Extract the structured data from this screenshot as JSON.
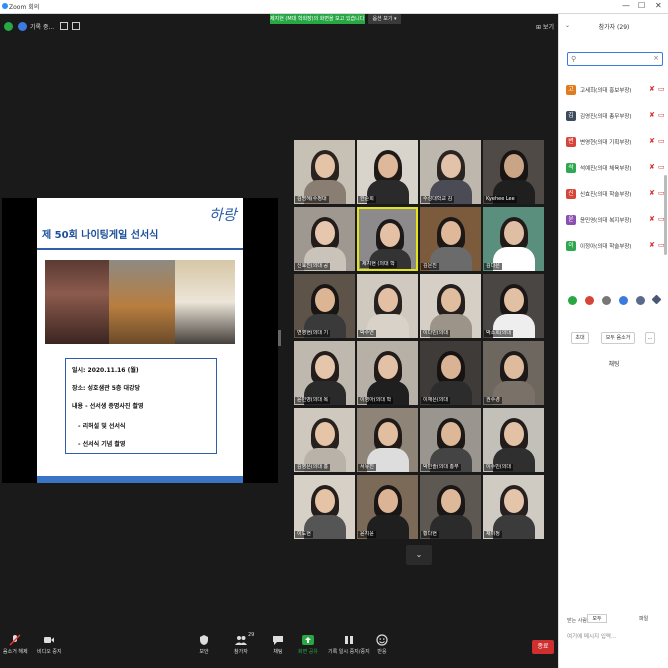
{
  "window": {
    "title": "Zoom 회의",
    "controls": [
      "—",
      "☐",
      "✕"
    ]
  },
  "top": {
    "meeting_label": "기록 중...",
    "banner": "제지현 (M대 학회장)의 화면을 보고 있습니다.",
    "view_button": "옵션 보기 ▾",
    "view_option": "⊞ 보기"
  },
  "slide": {
    "title": "제 50회 나이팅게일 선서식",
    "logo": "하랑",
    "lines": [
      "일시: 2020.11.16 (월)",
      "장소: 성호샘관 5층 대강당",
      "내용 - 선서생 증명사진 촬영",
      "  - 리허설 및 선서식",
      "  - 선서식 기념 촬영"
    ]
  },
  "tiles": [
    {
      "name": "김명혜(수정대",
      "bg": "#c7c0b5",
      "skin": "#e4c3a6",
      "hair": "#2a2320",
      "shirt": "#8a7e72"
    },
    {
      "name": "한준희",
      "bg": "#d8d3cb",
      "skin": "#dfb79b",
      "hair": "#1e1a18",
      "shirt": "#2a2a2a"
    },
    {
      "name": "수성대학교 김",
      "bg": "#bdb7ad",
      "skin": "#e2c2a8",
      "hair": "#2b2522",
      "shirt": "#4b4b55"
    },
    {
      "name": "Kyehee Lee",
      "bg": "#4f4a45",
      "skin": "#caa486",
      "hair": "#171413",
      "shirt": "#1f1f1f"
    },
    {
      "name": "신효진(의대 공",
      "bg": "#9e9890",
      "skin": "#e6c7ad",
      "hair": "#221d1b",
      "shirt": "#c9c3ba"
    },
    {
      "name": "제지현 (의대 학",
      "bg": "#8c8a8a",
      "skin": "#e4c1a4",
      "hair": "#1d1918",
      "shirt": "#333"
    },
    {
      "name": "김은진",
      "bg": "#7c5a3c",
      "skin": "#deb899",
      "hair": "#1c1816",
      "shirt": "#6b6b6b"
    },
    {
      "name": "김다은",
      "bg": "#5b8f7d",
      "skin": "#e0bea3",
      "hair": "#201b19",
      "shirt": "#ffffff"
    },
    {
      "name": "변영현(의대 기",
      "bg": "#5d5349",
      "skin": "#dcb595",
      "hair": "#1a1615",
      "shirt": "#3a3a3a"
    },
    {
      "name": "박수연",
      "bg": "#cfc9bf",
      "skin": "#e3c0a3",
      "hair": "#272120",
      "shirt": "#d8d2c8"
    },
    {
      "name": "이다빈(의대",
      "bg": "#d5cfc6",
      "skin": "#e0bd9f",
      "hair": "#241f1d",
      "shirt": "#9c9488"
    },
    {
      "name": "박소희(의대",
      "bg": "#4a4643",
      "skin": "#e2c0a4",
      "hair": "#1b1716",
      "shirt": "#eeeeee"
    },
    {
      "name": "윤민영(의대 복",
      "bg": "#bfb8ae",
      "skin": "#e6c6ab",
      "hair": "#231e1c",
      "shirt": "#2a2a2a"
    },
    {
      "name": "이영아(의대 학",
      "bg": "#b7b0a6",
      "skin": "#e2c1a6",
      "hair": "#211c1a",
      "shirt": "#1f1f1f"
    },
    {
      "name": "이재은(의대",
      "bg": "#3f3b38",
      "skin": "#d9b394",
      "hair": "#161312",
      "shirt": "#2c2c2c"
    },
    {
      "name": "권수경",
      "bg": "#6e675f",
      "skin": "#dfbb9d",
      "hair": "#1d1918",
      "shirt": "#7a7268"
    },
    {
      "name": "김영은(의대 홍",
      "bg": "#cfc8be",
      "skin": "#e5c4a8",
      "hair": "#28221f",
      "shirt": "#b9b2a8"
    },
    {
      "name": "서유진",
      "bg": "#8e8477",
      "skin": "#e0be9f",
      "hair": "#1f1a18",
      "shirt": "#ddd"
    },
    {
      "name": "박민솔(의대 총무",
      "bg": "#9a958f",
      "skin": "#dcb798",
      "hair": "#1c1816",
      "shirt": "#444"
    },
    {
      "name": "이수빈(의대",
      "bg": "#c3c0ba",
      "skin": "#e3c1a4",
      "hair": "#221d1b",
      "shirt": "#2f2f2f"
    },
    {
      "name": "이도현",
      "bg": "#d6d0c6",
      "skin": "#e4c3a7",
      "hair": "#241f1d",
      "shirt": "#555"
    },
    {
      "name": "윤지윤",
      "bg": "#7b6a58",
      "skin": "#dab494",
      "hair": "#1a1615",
      "shirt": "#1f1f1f"
    },
    {
      "name": "황다현",
      "bg": "#5e5852",
      "skin": "#ddb999",
      "hair": "#1b1716",
      "shirt": "#2b2b2b"
    },
    {
      "name": "채미정",
      "bg": "#cfcac2",
      "skin": "#e5c5aa",
      "hair": "#262120",
      "shirt": "#3b3b3b"
    }
  ],
  "toolbar": {
    "items": [
      {
        "label": "음소거 해제",
        "icon": "mic-muted-icon"
      },
      {
        "label": "비디오 중지",
        "icon": "video-icon"
      },
      {
        "label": "보안",
        "icon": "shield-icon"
      },
      {
        "label": "참가자",
        "icon": "participants-icon",
        "count": "29"
      },
      {
        "label": "채팅",
        "icon": "chat-icon"
      },
      {
        "label": "화면 공유",
        "icon": "share-screen-icon"
      },
      {
        "label": "기록 일시 중지/중지",
        "icon": "pause-record-icon"
      },
      {
        "label": "반응",
        "icon": "reactions-icon"
      }
    ],
    "end": "종료"
  },
  "panel": {
    "title": "참가자 (29)",
    "participants": [
      {
        "name": "고세희(의대 홍보부장)",
        "initial": "고",
        "color": "#e07a1f"
      },
      {
        "name": "김영진(의대 총무부장)",
        "initial": "김",
        "color": "#3c4a5c"
      },
      {
        "name": "변영현(의대 기획부장)",
        "initial": "변",
        "color": "#d6453a"
      },
      {
        "name": "석예진(의대 체육부장)",
        "initial": "석",
        "color": "#2fa84f"
      },
      {
        "name": "신효진(의대 학술부장)",
        "initial": "신",
        "color": "#d6453a"
      },
      {
        "name": "윤민영(의대 복지부장)",
        "initial": "윤",
        "color": "#8a4fb0"
      },
      {
        "name": "이정아(의대 학술부장)",
        "initial": "이",
        "color": "#2fa84f"
      }
    ],
    "buttons": [
      "초대",
      "모두 음소거",
      "..."
    ],
    "chat_title": "채팅",
    "recv_label": "받는 사람:",
    "recv_value": "모두",
    "file_label": "파일",
    "chat_placeholder": "여기에 메시지 입력..."
  }
}
